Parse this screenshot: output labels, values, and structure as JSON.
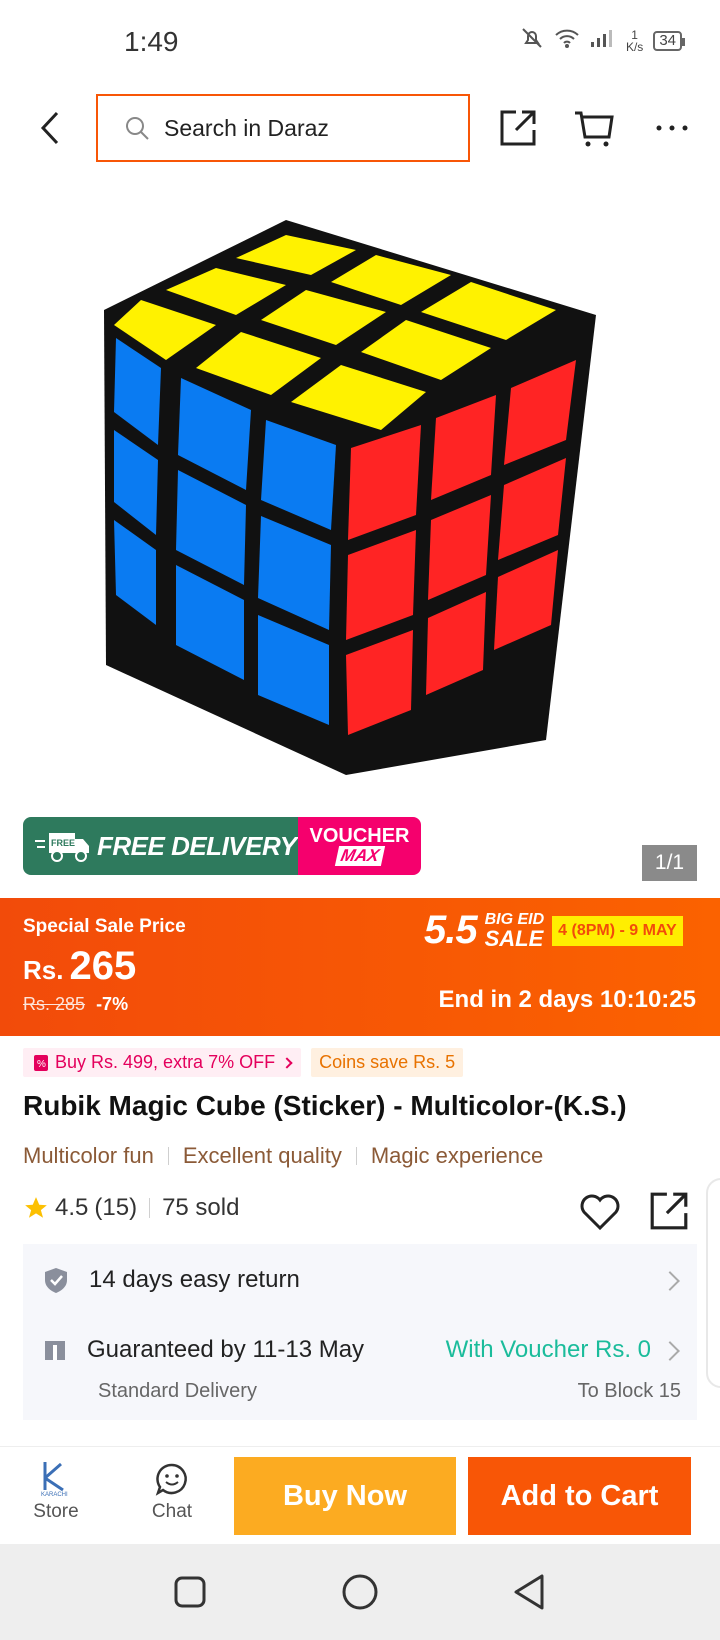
{
  "status_bar": {
    "time": "1:49",
    "speed_value": "1",
    "speed_unit": "K/s",
    "battery": "34"
  },
  "header": {
    "search_placeholder": "Search in Daraz"
  },
  "gallery": {
    "counter": "1/1"
  },
  "badges": {
    "delivery_tag": "FREE",
    "delivery": "FREE DELIVERY",
    "voucher_line1": "VOUCHER",
    "voucher_line2": "MAX"
  },
  "sale": {
    "label": "Special Sale Price",
    "currency": "Rs.",
    "price": "265",
    "original_price": "Rs. 285",
    "discount": "-7%",
    "event_number": "5.5",
    "event_line1": "BIG EID",
    "event_line2": "SALE",
    "event_dates": "4 (8PM) - 9 MAY",
    "countdown": "End in 2 days 10:10:25"
  },
  "promos": {
    "bundle": "Buy Rs. 499, extra 7% OFF",
    "coins": "Coins save Rs. 5"
  },
  "product": {
    "title": "Rubik Magic Cube (Sticker) - Multicolor-(K.S.)",
    "tags": [
      "Multicolor fun",
      "Excellent quality",
      "Magic experience"
    ],
    "rating": "4.5",
    "rating_count": "(15)",
    "sold": "75 sold"
  },
  "service": {
    "returns": "14 days easy return",
    "delivery": "Guaranteed by 11-13 May",
    "delivery_type": "Standard Delivery",
    "voucher": "With Voucher Rs. 0",
    "destination": "To Block 15"
  },
  "bottom_bar": {
    "store": "Store",
    "store_logo_text": "KARACHI",
    "chat": "Chat",
    "buy_now": "Buy Now",
    "add_to_cart": "Add to Cart"
  },
  "colors": {
    "brand_orange": "#f85606",
    "buy_now": "#fcab21",
    "voucher_green": "#1bbc9b",
    "delivery_green": "#2e7a5d",
    "voucher_pink": "#f5006d"
  }
}
